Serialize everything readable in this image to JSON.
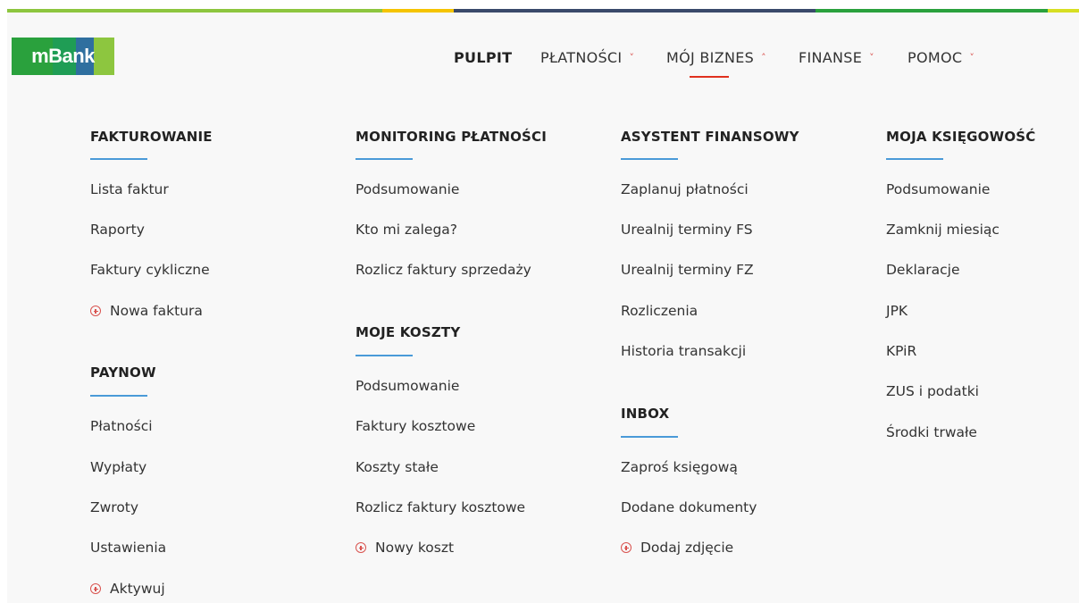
{
  "brand": {
    "logo_text": "mBank",
    "colors": [
      "#e2231a",
      "#f5a800",
      "#2f3f88",
      "#8dc63f",
      "#2aa13d"
    ]
  },
  "nav": {
    "items": [
      {
        "label": "PULPIT",
        "has_chevron": false,
        "active": false
      },
      {
        "label": "PŁATNOŚCI",
        "has_chevron": true,
        "active": false
      },
      {
        "label": "MÓJ BIZNES",
        "has_chevron": true,
        "active": true
      },
      {
        "label": "FINANSE",
        "has_chevron": true,
        "active": false
      },
      {
        "label": "POMOC",
        "has_chevron": true,
        "active": false
      }
    ],
    "chevron_down": "˅",
    "chevron_up": "˄",
    "accent_color": "#e0301e"
  },
  "menu": {
    "fakturowanie": {
      "title": "FAKTUROWANIE",
      "items": [
        "Lista faktur",
        "Raporty",
        "Faktury cykliczne"
      ],
      "add": "Nowa faktura"
    },
    "paynow": {
      "title": "PAYNOW",
      "items": [
        "Płatności",
        "Wypłaty",
        "Zwroty",
        "Ustawienia"
      ],
      "add": "Aktywuj"
    },
    "monitoring": {
      "title": "MONITORING PŁATNOŚCI",
      "items": [
        "Podsumowanie",
        "Kto mi zalega?",
        "Rozlicz faktury sprzedaży"
      ]
    },
    "koszty": {
      "title": "MOJE KOSZTY",
      "items": [
        "Podsumowanie",
        "Faktury kosztowe",
        "Koszty stałe",
        "Rozlicz faktury kosztowe"
      ],
      "add": "Nowy koszt"
    },
    "asystent": {
      "title": "ASYSTENT FINANSOWY",
      "items": [
        "Zaplanuj płatności",
        "Urealnij terminy FS",
        "Urealnij terminy FZ",
        "Rozliczenia",
        "Historia transakcji"
      ]
    },
    "inbox": {
      "title": "INBOX",
      "items": [
        "Zaproś księgową",
        "Dodane dokumenty"
      ],
      "add": "Dodaj zdjęcie"
    },
    "ksiegowosc": {
      "title": "MOJA KSIĘGOWOŚĆ",
      "items": [
        "Podsumowanie",
        "Zamknij miesiąc",
        "Deklaracje",
        "JPK",
        "KPiR",
        "ZUS i podatki",
        "Środki trwałe"
      ]
    }
  }
}
